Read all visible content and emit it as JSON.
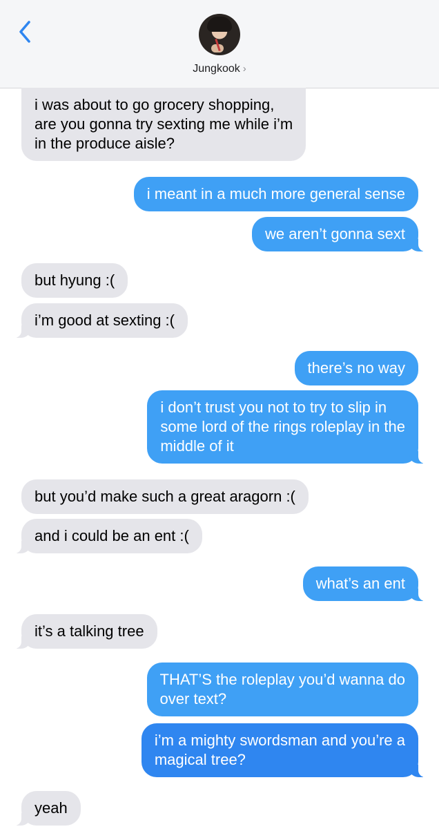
{
  "header": {
    "contact_name": "Jungkook",
    "chevron": "›",
    "back_icon": "chevron-left-icon",
    "accent_color": "#2f86f0"
  },
  "messages": [
    {
      "sender": "them",
      "text": "i was about to go grocery shopping,\nare you gonna try sexting me while i’m\nin the produce aisle?"
    },
    {
      "sender": "me",
      "text": "i meant in a much more general sense"
    },
    {
      "sender": "me",
      "text": "we aren’t gonna sext"
    },
    {
      "sender": "them",
      "text": "but hyung :("
    },
    {
      "sender": "them",
      "text": "i’m good at sexting :("
    },
    {
      "sender": "me",
      "text": "there’s no way"
    },
    {
      "sender": "me",
      "text": "i don’t trust you not to try to slip in\nsome lord of the rings roleplay in the\nmiddle of it"
    },
    {
      "sender": "them",
      "text": "but you’d make such a great aragorn :("
    },
    {
      "sender": "them",
      "text": "and i could be an ent :("
    },
    {
      "sender": "me",
      "text": "what’s an ent"
    },
    {
      "sender": "them",
      "text": "it’s a talking tree"
    },
    {
      "sender": "me",
      "text": "THAT’S the roleplay you’d wanna do\nover text?"
    },
    {
      "sender": "me",
      "text": "i’m a mighty swordsman and you’re a\nmagical tree?"
    },
    {
      "sender": "them",
      "text": "yeah"
    }
  ]
}
